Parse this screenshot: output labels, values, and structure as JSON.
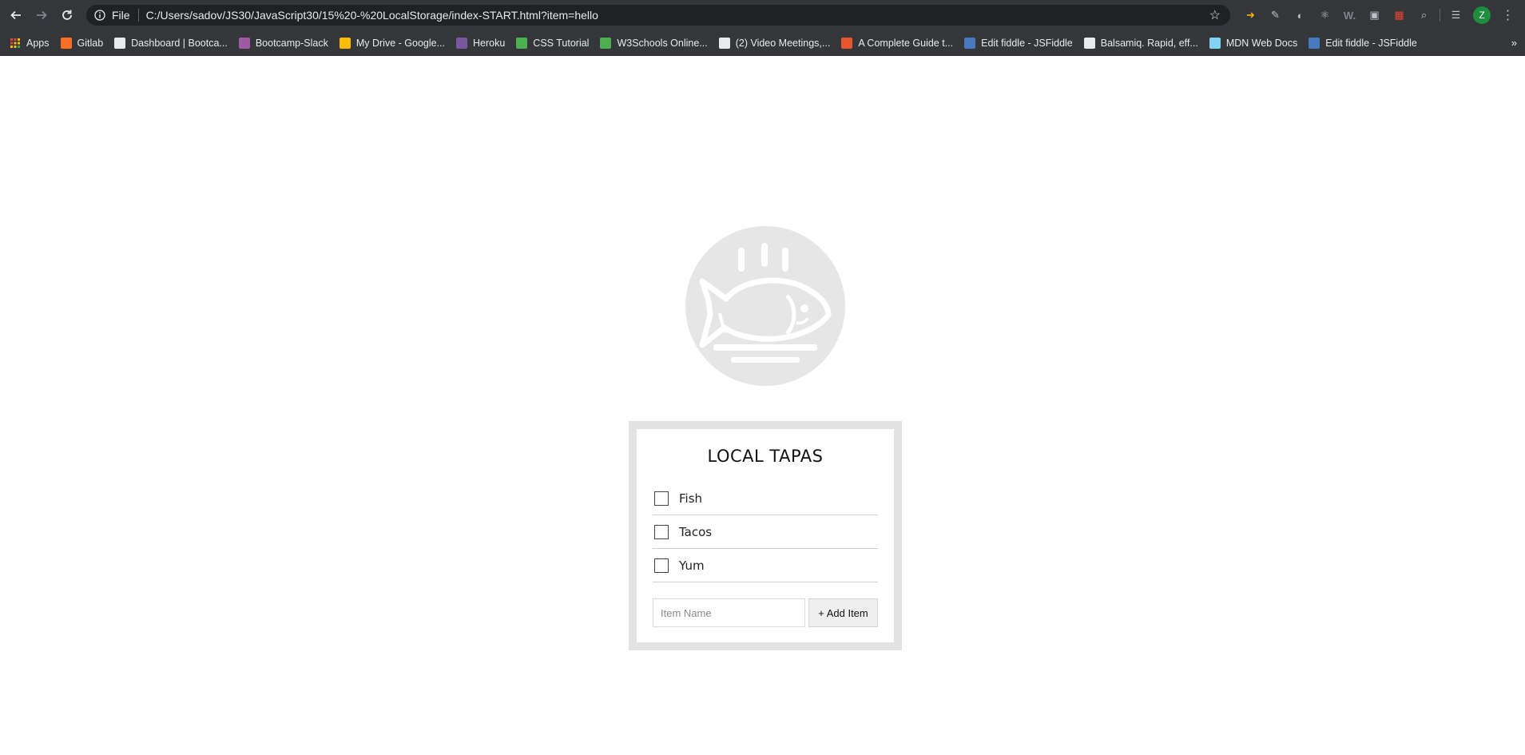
{
  "browser": {
    "url_scheme_label": "File",
    "url": "C:/Users/sadov/JS30/JavaScript30/15%20-%20LocalStorage/index-START.html?item=hello",
    "bookmarks": [
      {
        "label": "Apps",
        "icon": "apps-grid-icon",
        "color": "#e37400"
      },
      {
        "label": "Gitlab",
        "icon": "gitlab-icon",
        "color": "#fc6d26"
      },
      {
        "label": "Dashboard | Bootca...",
        "icon": "globe-icon",
        "color": "#e8eaed"
      },
      {
        "label": "Bootcamp-Slack",
        "icon": "slack-icon",
        "color": "#9d5ba3"
      },
      {
        "label": "My Drive - Google...",
        "icon": "google-drive-icon",
        "color": "#fbbc04"
      },
      {
        "label": "Heroku",
        "icon": "heroku-icon",
        "color": "#79589f"
      },
      {
        "label": "CSS Tutorial",
        "icon": "w3schools-icon",
        "color": "#4caf50"
      },
      {
        "label": "W3Schools Online...",
        "icon": "w3schools-icon",
        "color": "#4caf50"
      },
      {
        "label": "(2) Video Meetings,...",
        "icon": "wikipedia-icon",
        "color": "#e8eaed"
      },
      {
        "label": "A Complete Guide t...",
        "icon": "css-tricks-icon",
        "color": "#e8542c"
      },
      {
        "label": "Edit fiddle - JSFiddle",
        "icon": "jsfiddle-icon",
        "color": "#4679bd"
      },
      {
        "label": "Balsamiq. Rapid, eff...",
        "icon": "balsamiq-icon",
        "color": "#e8eaed"
      },
      {
        "label": "MDN Web Docs",
        "icon": "mdn-icon",
        "color": "#83d0f2"
      },
      {
        "label": "Edit fiddle - JSFiddle",
        "icon": "jsfiddle-icon",
        "color": "#4679bd"
      }
    ],
    "profile_initial": "Z"
  },
  "page": {
    "title": "LOCAL TAPAS",
    "items": [
      {
        "label": "Fish",
        "checked": false
      },
      {
        "label": "Tacos",
        "checked": false
      },
      {
        "label": "Yum",
        "checked": false
      }
    ],
    "input_placeholder": "Item Name",
    "add_button_label": "+ Add Item"
  }
}
